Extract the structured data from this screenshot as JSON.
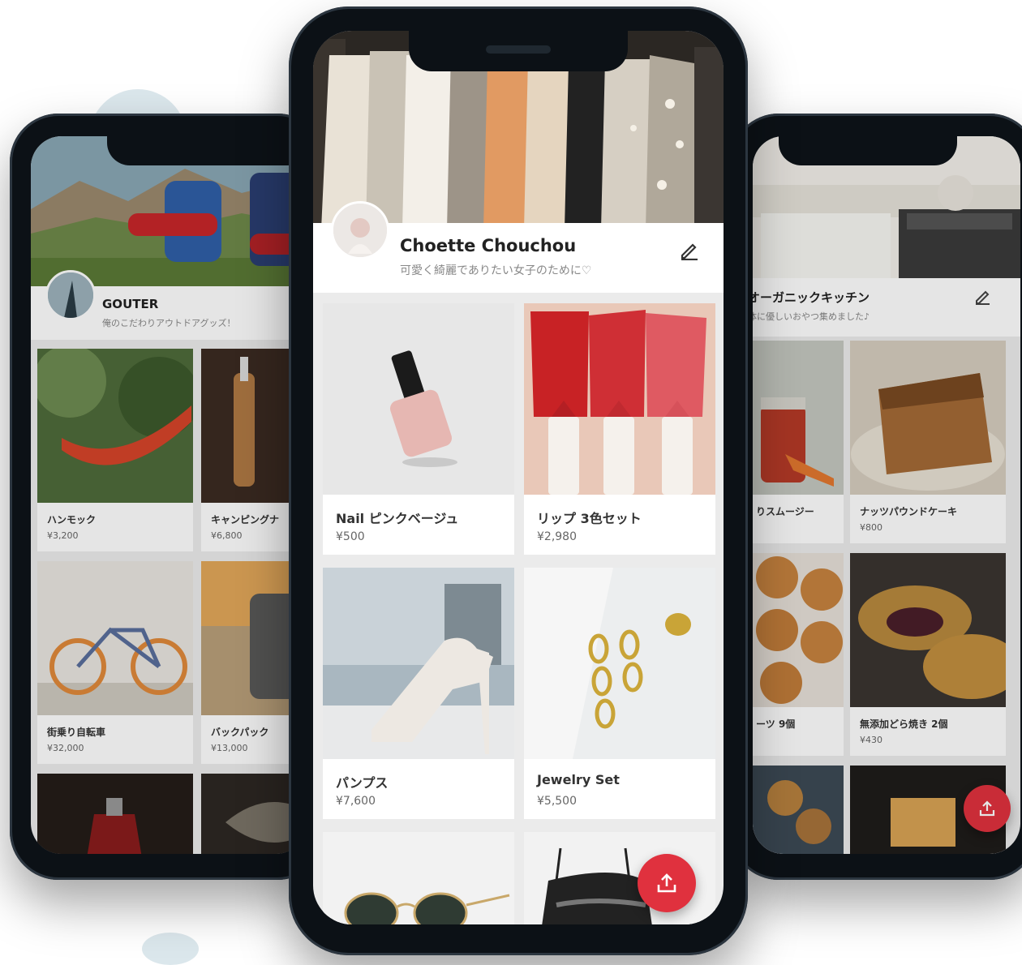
{
  "colors": {
    "accent": "#e0313e",
    "background": "#ffffff",
    "card": "#ffffff"
  },
  "left_phone": {
    "shop_name": "GOUTER",
    "shop_desc": "俺のこだわりアウトドアグッズ！",
    "items": [
      {
        "name": "ハンモック",
        "price": "¥3,200"
      },
      {
        "name": "キャンピングナ",
        "price": "¥6,800"
      },
      {
        "name": "街乗り自転車",
        "price": "¥32,000"
      },
      {
        "name": "バックパック",
        "price": "¥13,000"
      }
    ]
  },
  "center_phone": {
    "shop_name": "Choette Chouchou",
    "shop_desc": "可愛く綺麗でありたい女子のために♡",
    "items": [
      {
        "name": "Nail ピンクベージュ",
        "price": "¥500"
      },
      {
        "name": "リップ 3色セット",
        "price": "¥2,980"
      },
      {
        "name": "パンプス",
        "price": "¥7,600"
      },
      {
        "name": "Jewelry Set",
        "price": "¥5,500"
      }
    ]
  },
  "right_phone": {
    "shop_name": "オーガニックキッチン",
    "shop_desc": "体に優しいおやつ集めました♪",
    "items": [
      {
        "name": "りスムージー",
        "price": ""
      },
      {
        "name": "ナッツパウンドケーキ",
        "price": "¥800"
      },
      {
        "name": "ーツ 9個",
        "price": ""
      },
      {
        "name": "無添加どら焼き 2個",
        "price": "¥430"
      }
    ]
  },
  "icons": {
    "edit": "pencil-icon",
    "share": "share-upload-icon"
  }
}
